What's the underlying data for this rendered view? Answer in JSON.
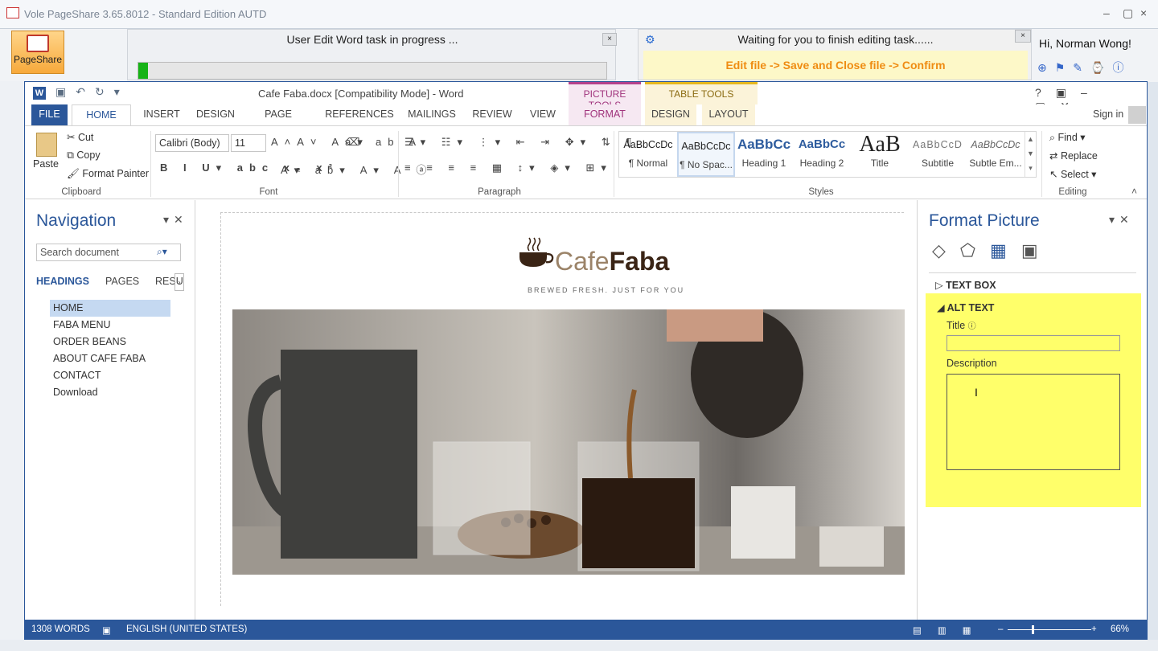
{
  "vole": {
    "title": "Vole PageShare  3.65.8012 - Standard Edition AUTD",
    "pageshare_label": "PageShare",
    "task_left": "User Edit Word task in progress ...",
    "progress": 0.02,
    "task_right": "Waiting for you to finish editing task......",
    "instruction": "Edit file -> Save and Close file -> Confirm",
    "greeting": "Hi, Norman Wong!",
    "close_glyph": "×"
  },
  "word": {
    "doc_title": "Cafe Faba.docx [Compatibility Mode] - Word",
    "ctx_picture": "PICTURE TOOLS",
    "ctx_table": "TABLE TOOLS",
    "sign_in": "Sign in",
    "tabs": [
      "FILE",
      "HOME",
      "INSERT",
      "DESIGN",
      "PAGE LAYOUT",
      "REFERENCES",
      "MAILINGS",
      "REVIEW",
      "VIEW",
      "FORMAT",
      "DESIGN",
      "LAYOUT"
    ],
    "clipboard": {
      "paste": "Paste",
      "cut": "Cut",
      "copy": "Copy",
      "format_painter": "Format Painter",
      "label": "Clipboard"
    },
    "font": {
      "name": "Calibri (Body)",
      "size": "11",
      "label": "Font"
    },
    "paragraph_label": "Paragraph",
    "styles": {
      "label": "Styles",
      "items": [
        {
          "preview": "AaBbCcDc",
          "name": "¶ Normal"
        },
        {
          "preview": "AaBbCcDc",
          "name": "¶ No Spac..."
        },
        {
          "preview": "AaBbCc",
          "name": "Heading 1"
        },
        {
          "preview": "AaBbCc",
          "name": "Heading 2"
        },
        {
          "preview": "AaB",
          "name": "Title"
        },
        {
          "preview": "AaBbCcD",
          "name": "Subtitle"
        },
        {
          "preview": "AaBbCcDc",
          "name": "Subtle Em..."
        }
      ]
    },
    "editing": {
      "find": "Find",
      "replace": "Replace",
      "select": "Select",
      "label": "Editing"
    }
  },
  "navigation": {
    "title": "Navigation",
    "search_placeholder": "Search document",
    "tabs": [
      "HEADINGS",
      "PAGES",
      "RESU"
    ],
    "items": [
      "HOME",
      "FABA MENU",
      "ORDER BEANS",
      "ABOUT CAFE FABA",
      "CONTACT",
      "Download"
    ]
  },
  "document": {
    "logo_light": "Cafe",
    "logo_bold": "Faba",
    "tagline": "BREWED FRESH. JUST FOR YOU"
  },
  "format_picture": {
    "title": "Format Picture",
    "text_box": "TEXT BOX",
    "alt_text": "ALT TEXT",
    "title_label": "Title",
    "description_label": "Description"
  },
  "status": {
    "words": "1308 WORDS",
    "language": "ENGLISH (UNITED STATES)",
    "zoom": "66%"
  }
}
